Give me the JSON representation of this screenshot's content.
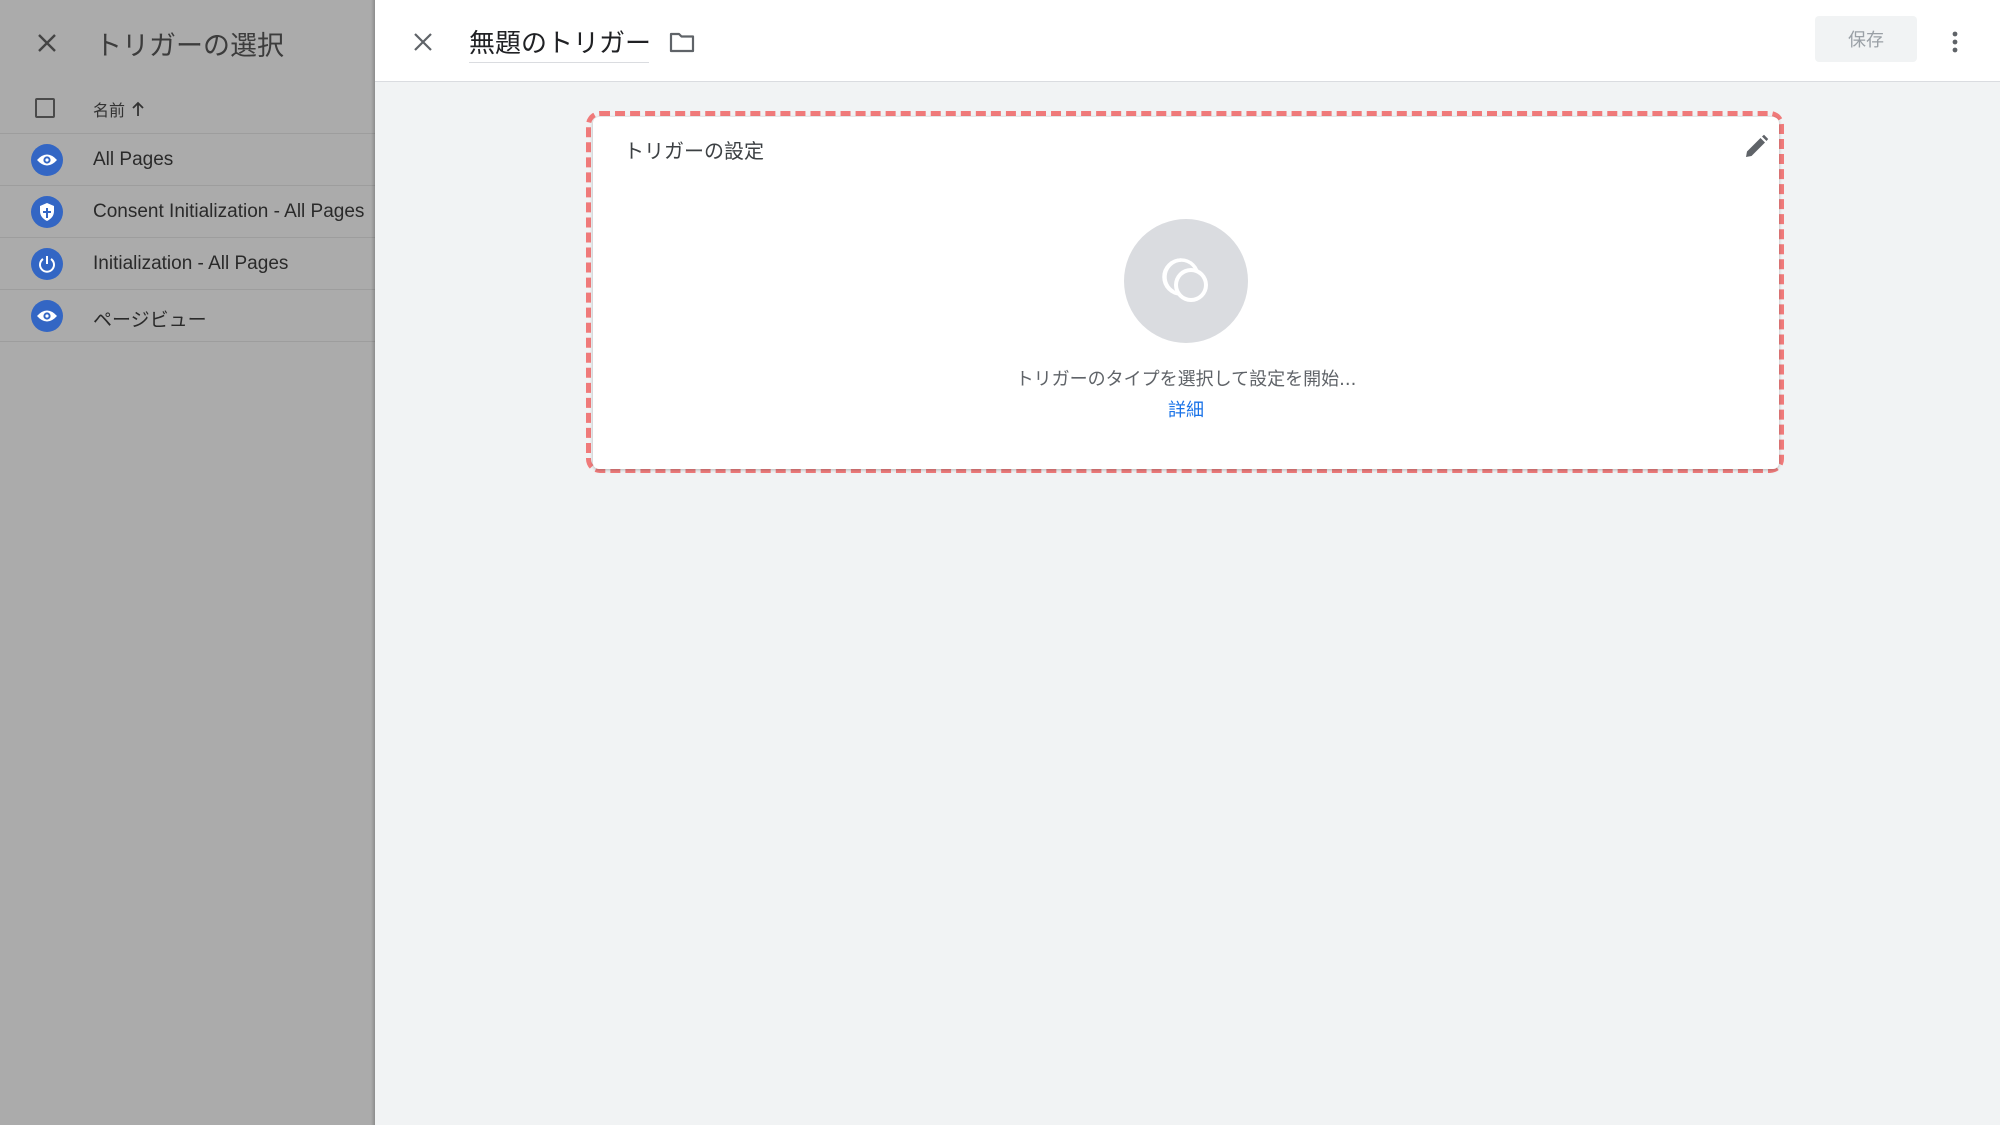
{
  "left_panel": {
    "title": "トリガーの選択",
    "column_name": "名前",
    "items": [
      {
        "label": "All Pages",
        "icon": "eye-icon"
      },
      {
        "label": "Consent Initialization - All Pages",
        "icon": "shield-icon"
      },
      {
        "label": "Initialization - All Pages",
        "icon": "power-icon"
      },
      {
        "label": "ページビュー",
        "icon": "eye-icon"
      }
    ]
  },
  "editor": {
    "trigger_name": "無題のトリガー",
    "save_label": "保存",
    "card_title": "トリガーの設定",
    "prompt": "トリガーのタイプを選択して設定を開始...",
    "learn_more": "詳細"
  },
  "colors": {
    "accent_blue": "#1a73e8",
    "icon_bubble": "#3366c4",
    "highlight": "#f07a7a",
    "overlay_gray": "#ababab"
  }
}
